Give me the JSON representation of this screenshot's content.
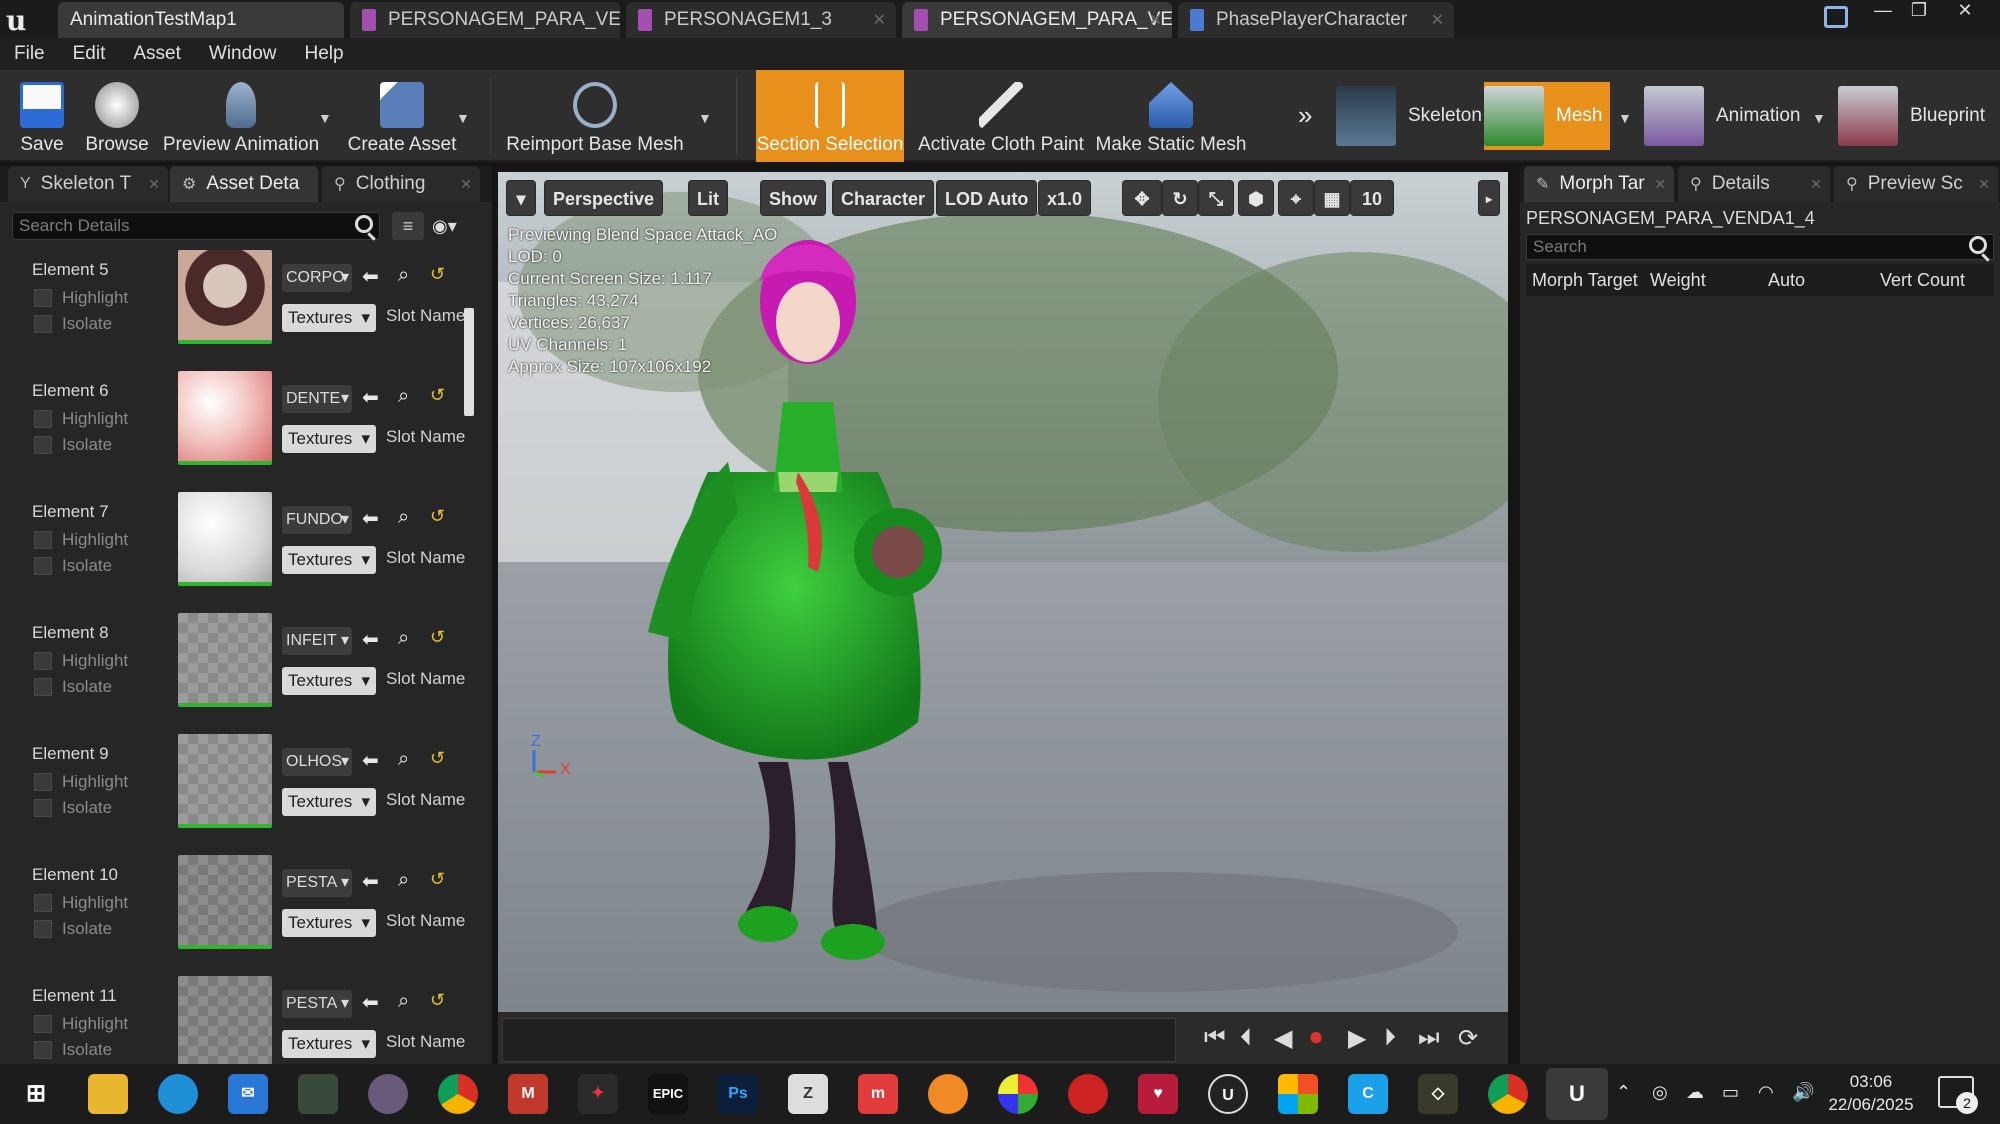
{
  "window": {
    "tabs": [
      {
        "label": "AnimationTestMap1",
        "active": true
      },
      {
        "label": "PERSONAGEM_PARA_VEI",
        "active": false
      },
      {
        "label": "PERSONAGEM1_3",
        "active": false
      },
      {
        "label": "PERSONAGEM_PARA_VEI",
        "active": false
      },
      {
        "label": "PhasePlayerCharacter",
        "active": false
      }
    ]
  },
  "menu": [
    "File",
    "Edit",
    "Asset",
    "Window",
    "Help"
  ],
  "toolbar": {
    "save": "Save",
    "browse": "Browse",
    "preview_animation": "Preview Animation",
    "create_asset": "Create Asset",
    "reimport": "Reimport Base Mesh",
    "section_selection": "Section Selection",
    "cloth_paint": "Activate Cloth Paint",
    "static_mesh": "Make Static Mesh",
    "modes": {
      "skeleton": "Skeleton",
      "mesh": "Mesh",
      "animation": "Animation",
      "blueprint": "Blueprint"
    }
  },
  "left_panel": {
    "tabs": [
      "Skeleton T",
      "Asset Deta",
      "Clothing"
    ],
    "search_placeholder": "Search Details",
    "highlight": "Highlight",
    "isolate": "Isolate",
    "textures": "Textures",
    "slot_name": "Slot Name",
    "elements": [
      {
        "label": "Element 5",
        "material": "CORPO"
      },
      {
        "label": "Element 6",
        "material": "DENTE"
      },
      {
        "label": "Element 7",
        "material": "FUNDO"
      },
      {
        "label": "Element 8",
        "material": "INFEIT"
      },
      {
        "label": "Element 9",
        "material": "OLHOS"
      },
      {
        "label": "Element 10",
        "material": "PESTA"
      },
      {
        "label": "Element 11",
        "material": "PESTA"
      }
    ]
  },
  "viewport": {
    "perspective": "Perspective",
    "lit": "Lit",
    "show": "Show",
    "character": "Character",
    "lod": "LOD Auto",
    "speed": "x1.0",
    "grid_size": "10",
    "stats": [
      "Previewing Blend Space Attack_AO",
      "LOD: 0",
      "Current Screen Size: 1.117",
      "Triangles: 43,274",
      "Vertices: 26,637",
      "UV Channels: 1",
      "Approx Size: 107x106x192"
    ],
    "axis_z": "Z",
    "axis_x": "X"
  },
  "right_panel": {
    "tabs": [
      "Morph Tar",
      "Details",
      "Preview Sc"
    ],
    "asset_name": "PERSONAGEM_PARA_VENDA1_4",
    "search_placeholder": "Search",
    "columns": [
      "Morph Target",
      "Weight",
      "Auto",
      "Vert Count"
    ]
  },
  "taskbar": {
    "time": "03:06",
    "date": "22/06/2025",
    "notification_count": "2",
    "app_labels": {
      "photoshop": "Ps",
      "epic": "EPIC",
      "m_app": "M"
    }
  },
  "colors": {
    "accent": "#e8901c",
    "selected_green": "#2fb52f"
  }
}
